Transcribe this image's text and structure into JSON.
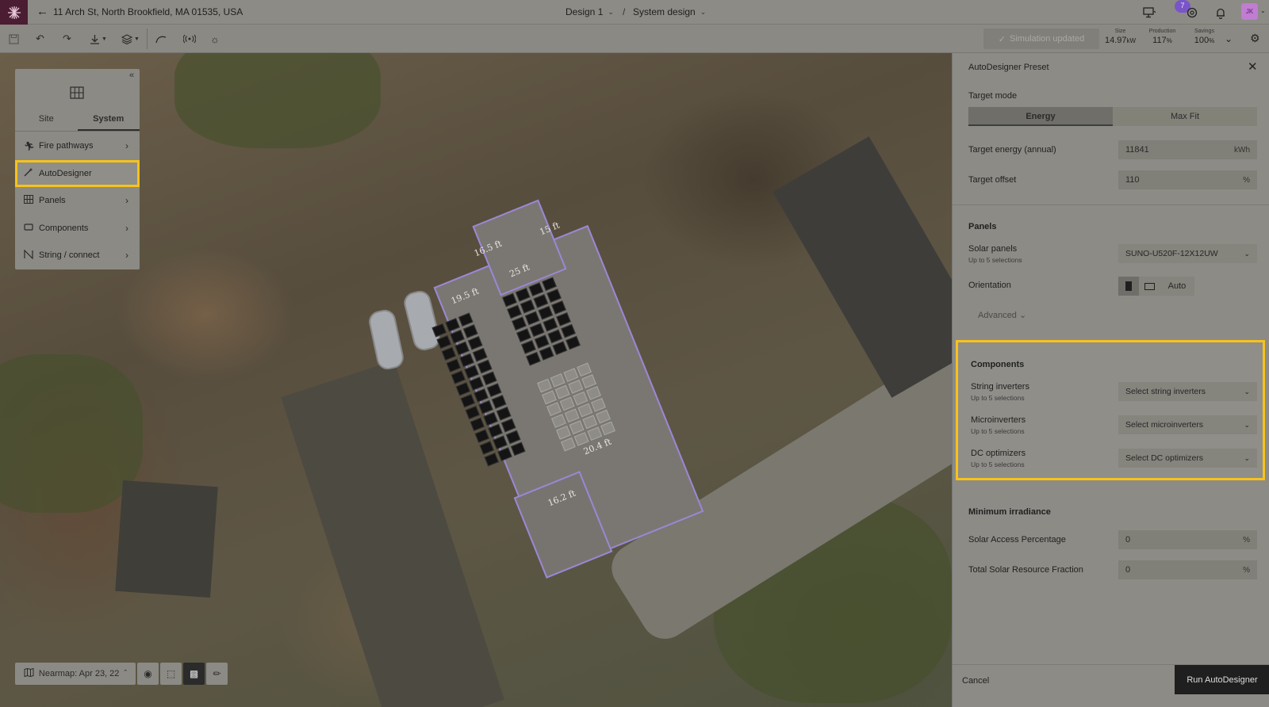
{
  "header": {
    "address": "11 Arch St, North Brookfield, MA 01535, USA",
    "design_crumb": "Design 1",
    "section_crumb": "System design",
    "crumb_separator": "/",
    "notification_count": "7",
    "avatar_initials": "JK"
  },
  "toolbar": {
    "simulation_label": "Simulation updated",
    "stats": [
      {
        "label": "Size",
        "value": "14.97",
        "unit": "kW"
      },
      {
        "label": "Production",
        "value": "117",
        "unit": "%"
      },
      {
        "label": "Savings",
        "value": "100",
        "unit": "%"
      }
    ]
  },
  "map": {
    "dimensions": [
      "19.5 ft",
      "25 ft",
      "16.5 ft",
      "15 ft",
      "20.4 ft",
      "16.2 ft"
    ]
  },
  "left_panel": {
    "tabs": [
      {
        "label": "Site",
        "active": false
      },
      {
        "label": "System",
        "active": true
      }
    ],
    "items": [
      {
        "label": "Fire pathways",
        "icon": "fire-pathways-icon",
        "has_arrow": true
      },
      {
        "label": "AutoDesigner",
        "icon": "autodesigner-wand-icon",
        "has_arrow": false,
        "highlighted": true
      },
      {
        "label": "Panels",
        "icon": "panels-grid-icon",
        "has_arrow": true
      },
      {
        "label": "Components",
        "icon": "components-icon",
        "has_arrow": true
      },
      {
        "label": "String / connect",
        "icon": "string-connect-icon",
        "has_arrow": true
      }
    ]
  },
  "map_bottom": {
    "imagery_label": "Nearmap: Apr 23, 22"
  },
  "right_panel": {
    "title": "AutoDesigner Preset",
    "target_mode": {
      "label": "Target mode",
      "options": [
        "Energy",
        "Max Fit"
      ],
      "selected": "Energy"
    },
    "target_energy": {
      "label": "Target energy (annual)",
      "value": "11841",
      "unit": "kWh"
    },
    "target_offset": {
      "label": "Target offset",
      "value": "110",
      "unit": "%"
    },
    "panels": {
      "heading": "Panels",
      "solar_panels_label": "Solar panels",
      "solar_panels_sub": "Up to 5 selections",
      "solar_panels_value": "SUNO-U520F-12X12UW",
      "orientation_label": "Orientation",
      "orientation_auto": "Auto",
      "advanced_label": "Advanced"
    },
    "components": {
      "heading": "Components",
      "rows": [
        {
          "label": "String inverters",
          "sub": "Up to 5 selections",
          "placeholder": "Select string inverters"
        },
        {
          "label": "Microinverters",
          "sub": "Up to 5 selections",
          "placeholder": "Select microinverters"
        },
        {
          "label": "DC optimizers",
          "sub": "Up to 5 selections",
          "placeholder": "Select DC optimizers"
        }
      ]
    },
    "irradiance": {
      "heading": "Minimum irradiance",
      "solar_access_label": "Solar Access Percentage",
      "solar_access_value": "0",
      "solar_access_unit": "%",
      "tsrf_label": "Total Solar Resource Fraction",
      "tsrf_value": "0",
      "tsrf_unit": "%"
    },
    "footer": {
      "cancel_label": "Cancel",
      "run_label": "Run AutoDesigner"
    }
  },
  "colors": {
    "highlight": "#f7c21a",
    "brand": "#4a1d33",
    "roof_outline": "#9b87d6"
  }
}
